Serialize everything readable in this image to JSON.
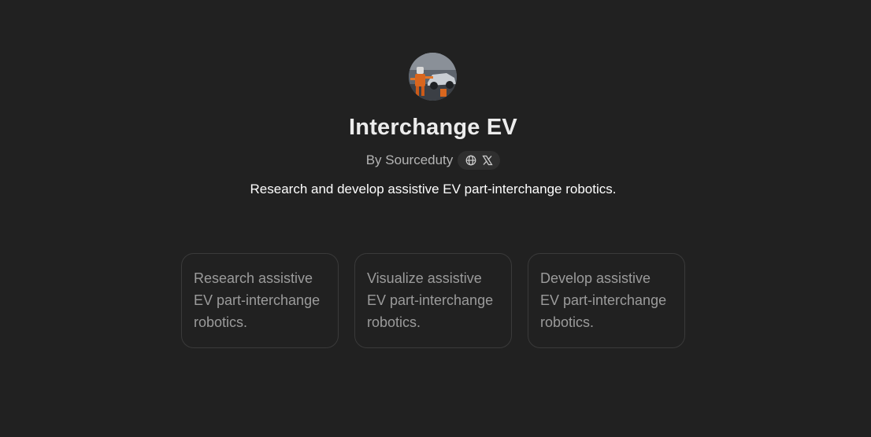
{
  "gpt": {
    "name": "Interchange EV",
    "author": "By Sourceduty",
    "description": "Research and develop assistive EV part-interchange robotics."
  },
  "social_icons": [
    "globe-icon",
    "x-icon"
  ],
  "starters": [
    {
      "text": "Research assistive EV part-interchange robotics."
    },
    {
      "text": "Visualize assistive EV part-interchange robotics."
    },
    {
      "text": "Develop assistive EV part-interchange robotics."
    }
  ],
  "colors": {
    "background": "#212121",
    "title": "#ececec",
    "muted": "#b4b4b4",
    "card_border": "#3a3a3a",
    "card_text": "#9b9b9b"
  }
}
